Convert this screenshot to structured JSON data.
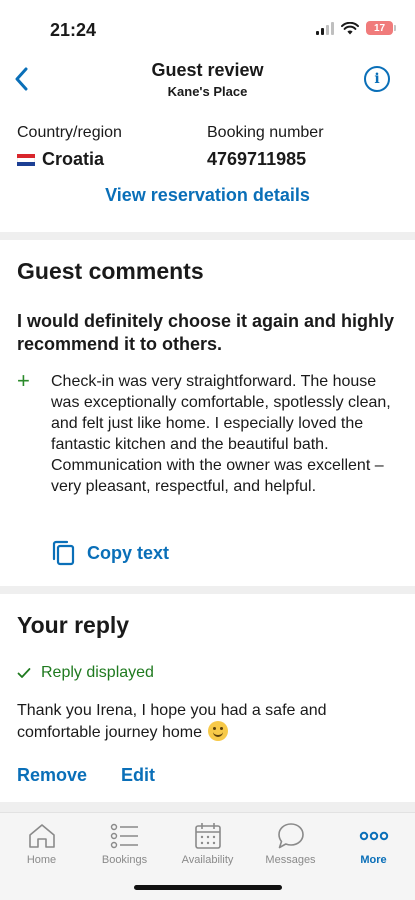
{
  "status_bar": {
    "time": "21:24",
    "battery": "17"
  },
  "header": {
    "title": "Guest review",
    "subtitle": "Kane's Place"
  },
  "booking": {
    "country_label": "Country/region",
    "country_value": "Croatia",
    "booking_label": "Booking number",
    "booking_value": "4769711985",
    "view_link": "View reservation details"
  },
  "comments": {
    "title": "Guest comments",
    "headline": "I would definitely choose it again and highly recommend it to others.",
    "positive": "Check-in was very straightforward. The house was exceptionally comfortable, spotlessly clean, and felt just like home. I especially loved the fantastic kitchen and the beautiful bath. Communication with the owner was excellent – very pleasant, respectful, and helpful.",
    "copy_label": "Copy text"
  },
  "reply": {
    "title": "Your reply",
    "status": "Reply displayed",
    "text": "Thank you Irena, I hope you had a safe and comfortable journey home",
    "remove_label": "Remove",
    "edit_label": "Edit"
  },
  "tabs": [
    {
      "label": "Home",
      "icon": "home-icon"
    },
    {
      "label": "Bookings",
      "icon": "list-icon"
    },
    {
      "label": "Availability",
      "icon": "calendar-icon"
    },
    {
      "label": "Messages",
      "icon": "chat-bubble-icon"
    },
    {
      "label": "More",
      "icon": "more-dots-icon",
      "active": true
    }
  ],
  "colors": {
    "accent": "#0a6fb8",
    "success": "#1f7a1f",
    "battery": "#f07b7b"
  }
}
